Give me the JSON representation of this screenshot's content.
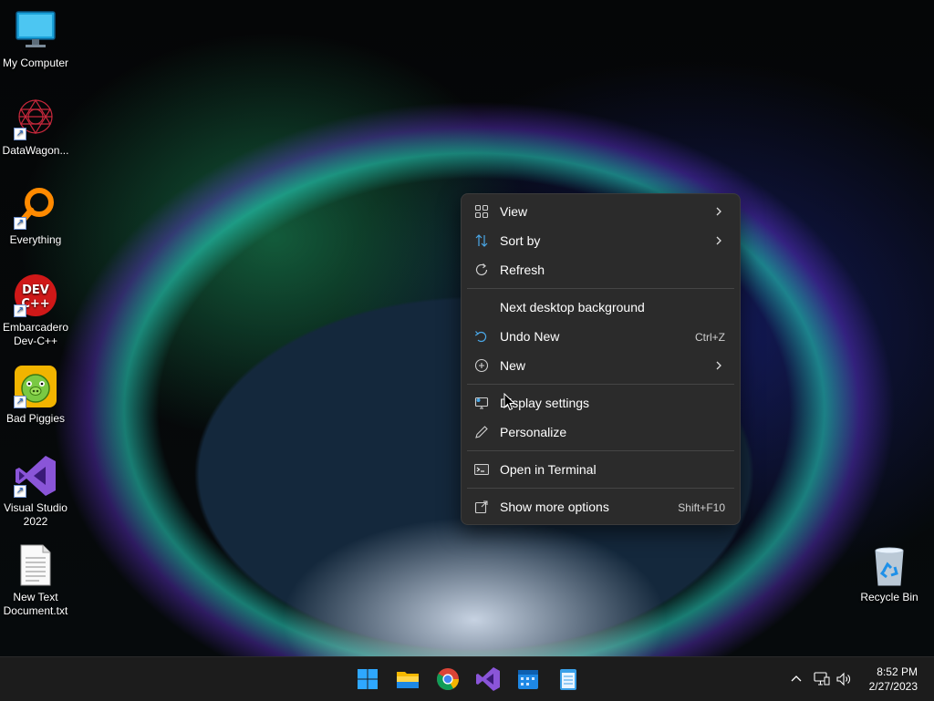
{
  "desktop_icons": [
    {
      "label": "My Computer"
    },
    {
      "label": "DataWagon..."
    },
    {
      "label": "Everything"
    },
    {
      "label": "Embarcadero Dev-C++"
    },
    {
      "label": "Bad Piggies"
    },
    {
      "label": "Visual Studio 2022"
    },
    {
      "label": "New Text Document.txt"
    },
    {
      "label": "Recycle Bin"
    }
  ],
  "context_menu": {
    "view": "View",
    "sort_by": "Sort by",
    "refresh": "Refresh",
    "next_background": "Next desktop background",
    "undo_new": "Undo New",
    "undo_shortcut": "Ctrl+Z",
    "new": "New",
    "display_settings": "Display settings",
    "personalize": "Personalize",
    "open_terminal": "Open in Terminal",
    "show_more": "Show more options",
    "show_more_shortcut": "Shift+F10"
  },
  "taskbar": {
    "apps": [
      "start-icon",
      "file-explorer-icon",
      "chrome-icon",
      "visual-studio-icon",
      "calendar-icon",
      "notepad-icon"
    ],
    "clock": {
      "time": "8:52 PM",
      "date": "2/27/2023"
    }
  }
}
